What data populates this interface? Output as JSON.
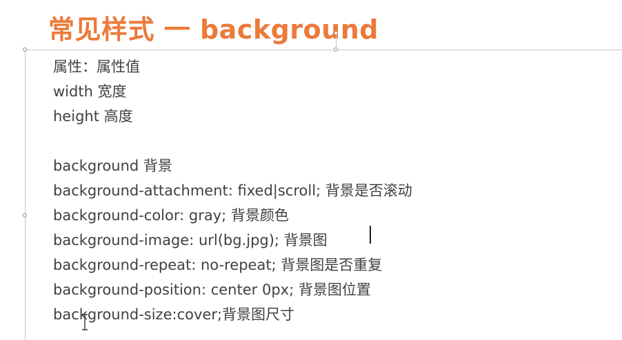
{
  "title": "常见样式 一 background",
  "lines": [
    "属性：属性值",
    "width 宽度",
    "height 高度",
    "",
    "background 背景",
    "background-attachment: fixed|scroll; 背景是否滚动",
    "background-color: gray; 背景颜色",
    "background-image: url(bg.jpg);  背景图",
    "background-repeat: no-repeat; 背景图是否重复",
    "background-position: center 0px; 背景图位置",
    "background-size:cover;背景图尺寸"
  ],
  "colors": {
    "title": "#ec7a3a",
    "text": "#404040"
  },
  "cursor_icon": "text-ibeam-cursor-icon"
}
